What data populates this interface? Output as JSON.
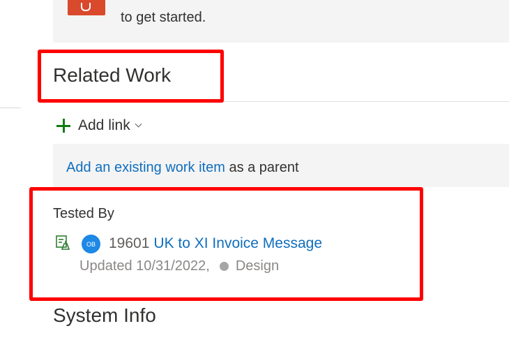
{
  "banner": {
    "text": "to get started."
  },
  "related_work": {
    "title": "Related Work",
    "add_link_label": "Add link",
    "parent_prompt": {
      "link_text": "Add an existing work item",
      "suffix": " as a parent"
    },
    "groups": [
      {
        "label": "Tested By",
        "items": [
          {
            "icon": "test-case-icon",
            "avatar_initials": "OB",
            "id": "19601",
            "title": "UK to XI Invoice Message",
            "updated": "Updated 10/31/2022,",
            "state": "Design",
            "state_color": "#a6a6a6"
          }
        ]
      }
    ]
  },
  "system_info": {
    "title": "System Info"
  },
  "colors": {
    "highlight": "#ff0000",
    "link": "#106ebe",
    "add_icon": "#107c10",
    "avatar": "#1e88e5"
  }
}
